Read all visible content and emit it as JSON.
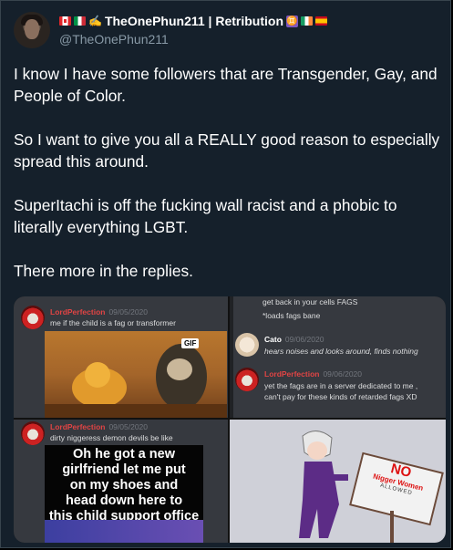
{
  "author": {
    "display_name": "TheOnePhun211 | Retribution",
    "handle": "@TheOnePhun211",
    "gemini_symbol": "♊"
  },
  "tweet": {
    "paragraphs": [
      "I know I have some followers that are Transgender, Gay, and People of Color.",
      "So I want to give you all a REALLY good reason to especially spread this around.",
      "SuperItachi is off the fucking wall racist and a phobic to literally everything LGBT.",
      "There more in the replies."
    ]
  },
  "media": {
    "panel1": {
      "username": "LordPerfection",
      "date": "09/05/2020",
      "message": "me if the child is a fag or transformer",
      "gif_badge": "GIF"
    },
    "panel2": {
      "line1": "get back in your cells FAGS",
      "line2": "*loads fags bane",
      "cato_name": "Cato",
      "cato_date": "09/06/2020",
      "cato_message": "hears noises and looks around, finds nothing",
      "lp_name": "LordPerfection",
      "lp_date": "09/06/2020",
      "lp_message1": "yet the fags are in a server dedicated to me ,",
      "lp_message2": "can't pay for these kinds of retarded fags XD"
    },
    "panel3": {
      "username": "LordPerfection",
      "date": "09/05/2020",
      "message": "dirty niggeress demon devils be like",
      "meme_lines": [
        "Oh he got a new",
        "girlfriend let me put",
        "on my shoes and",
        "head down here to",
        "this child support office"
      ]
    },
    "panel4": {
      "sign_no": "NO",
      "sign_text": "Nigger Women",
      "sign_sub": "ALLOWED"
    }
  },
  "colors": {
    "background": "#15202b",
    "secondary_text": "#8899a6",
    "discord_bg": "#36393f",
    "discord_name_red": "#e04444"
  }
}
